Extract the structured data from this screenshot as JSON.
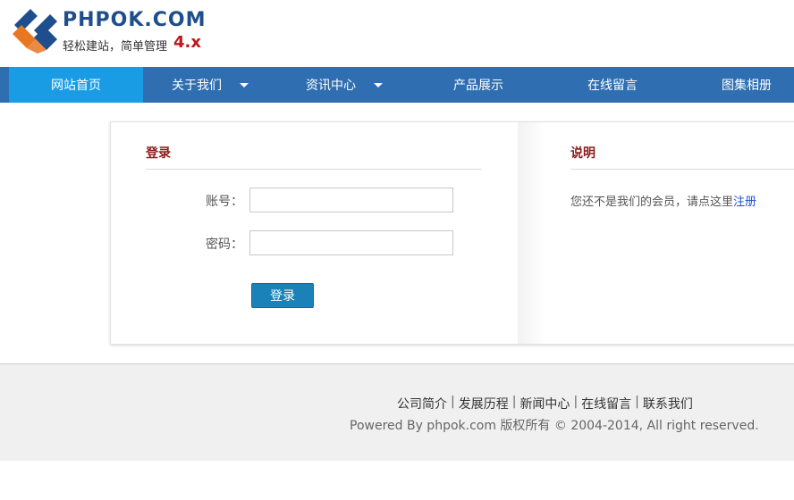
{
  "header": {
    "logo_title": "PHPOK.COM",
    "slogan": "轻松建站，简单管理",
    "version": "4.x",
    "brand_colors": {
      "blue": "#1f4e8c",
      "orange": "#e87722",
      "red": "#c0161c"
    }
  },
  "nav": {
    "items": [
      {
        "label": "网站首页",
        "active": true,
        "has_dropdown": false
      },
      {
        "label": "关于我们",
        "active": false,
        "has_dropdown": true
      },
      {
        "label": "资讯中心",
        "active": false,
        "has_dropdown": true
      },
      {
        "label": "产品展示",
        "active": false,
        "has_dropdown": false
      },
      {
        "label": "在线留言",
        "active": false,
        "has_dropdown": false
      },
      {
        "label": "图集相册",
        "active": false,
        "has_dropdown": false
      }
    ],
    "bg_color": "#2f6fb1",
    "active_color": "#1a9ce5"
  },
  "login": {
    "title": "登录",
    "account_label": "账号：",
    "account_value": "",
    "password_label": "密码：",
    "password_value": "",
    "submit_label": "登录"
  },
  "info": {
    "title": "说明",
    "text": "您还不是我们的会员，请点这里",
    "register_link": "注册"
  },
  "footer": {
    "links": [
      "公司简介",
      "发展历程",
      "新闻中心",
      "在线留言",
      "联系我们"
    ],
    "separator": "|",
    "copyright": "Powered By phpok.com 版权所有 © 2004-2014, All right reserved."
  }
}
